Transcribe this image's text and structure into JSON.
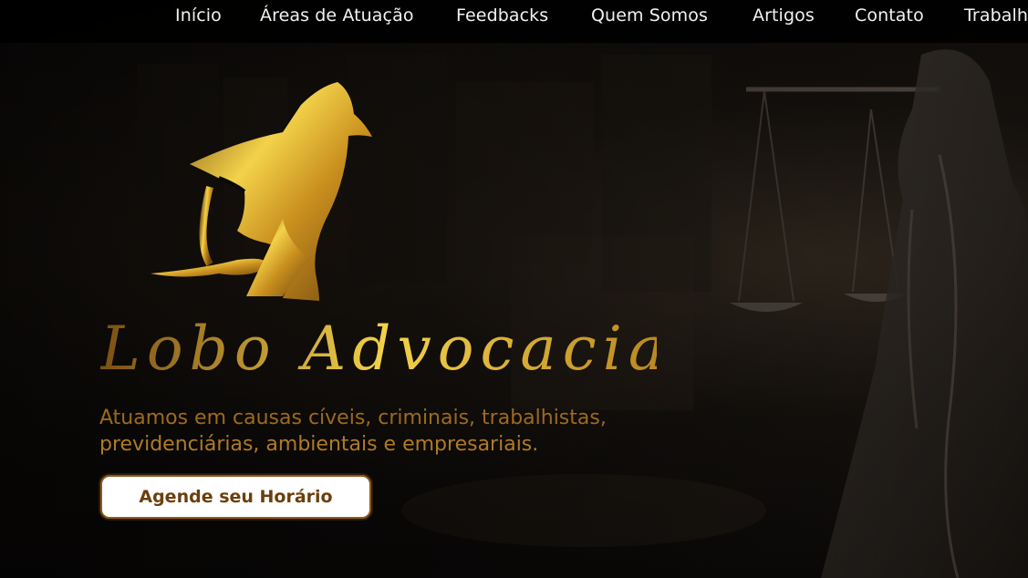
{
  "nav": {
    "items": [
      {
        "label": "Início"
      },
      {
        "label": "Áreas de Atuação"
      },
      {
        "label": "Feedbacks"
      },
      {
        "label": "Quem Somos"
      },
      {
        "label": "Artigos"
      },
      {
        "label": "Contato"
      },
      {
        "label": "Trabalh"
      }
    ]
  },
  "hero": {
    "brand_name": "Lobo Advocacia",
    "tagline_line1": "Atuamos em causas cíveis, criminais, trabalhistas,",
    "tagline_line2": "previdenciárias, ambientais e empresariais.",
    "cta_label": "Agende seu Horário",
    "logo_icon": "wolf-howling-icon",
    "background_image": "scales-of-justice-statue"
  },
  "colors": {
    "nav_background": "#000000",
    "nav_text": "#f1f1f1",
    "gold_light": "#f3d24a",
    "gold_mid": "#d4a72c",
    "gold_dark": "#7a4f13",
    "cta_background": "#ffffff",
    "cta_text": "#6b3f0c"
  }
}
